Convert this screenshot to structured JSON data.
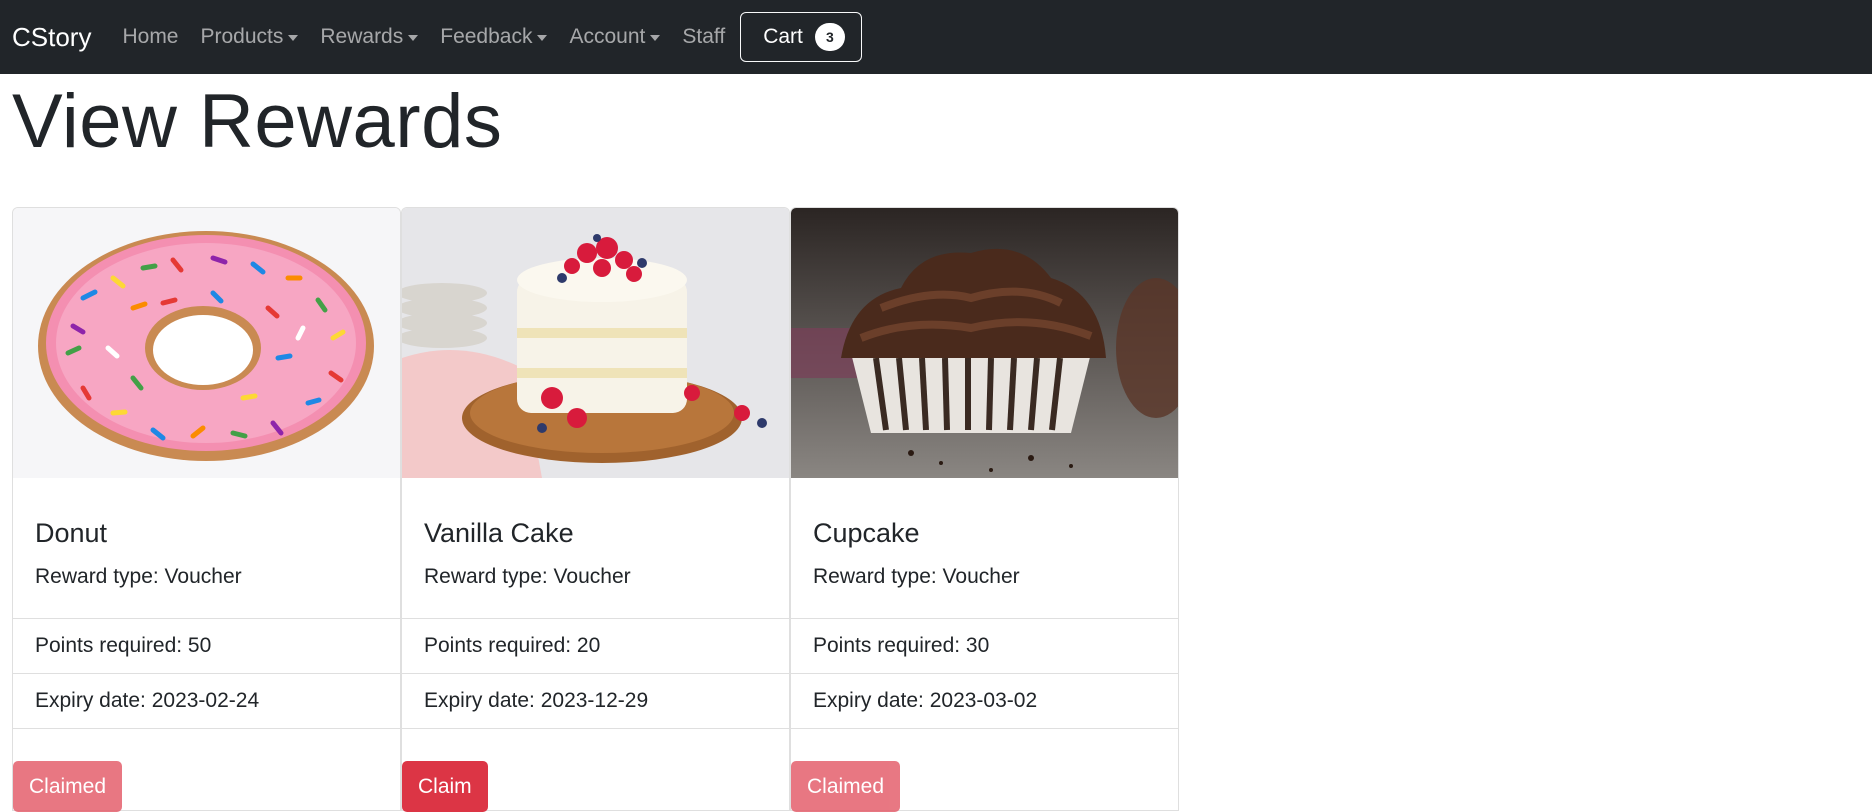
{
  "nav": {
    "brand": "CStory",
    "items": [
      {
        "label": "Home",
        "dropdown": false
      },
      {
        "label": "Products",
        "dropdown": true
      },
      {
        "label": "Rewards",
        "dropdown": true
      },
      {
        "label": "Feedback",
        "dropdown": true
      },
      {
        "label": "Account",
        "dropdown": true
      },
      {
        "label": "Staff",
        "dropdown": false
      }
    ],
    "cart_label": "Cart",
    "cart_count": "3"
  },
  "page": {
    "title": "View Rewards"
  },
  "rewards": [
    {
      "name": "Donut",
      "reward_type": "Reward type: Voucher",
      "points": "Points required: 50",
      "expiry": "Expiry date: 2023-02-24",
      "button": "Claimed",
      "image": "pink-sprinkle-donut"
    },
    {
      "name": "Vanilla Cake",
      "reward_type": "Reward type: Voucher",
      "points": "Points required: 20",
      "expiry": "Expiry date: 2023-12-29",
      "button": "Claim",
      "image": "vanilla-berry-cake"
    },
    {
      "name": "Cupcake",
      "reward_type": "Reward type: Voucher",
      "points": "Points required: 30",
      "expiry": "Expiry date: 2023-03-02",
      "button": "Claimed",
      "image": "chocolate-cupcake"
    }
  ],
  "colors": {
    "navbar": "#212529",
    "danger": "#dc3545",
    "danger_disabled": "#e4606d"
  }
}
